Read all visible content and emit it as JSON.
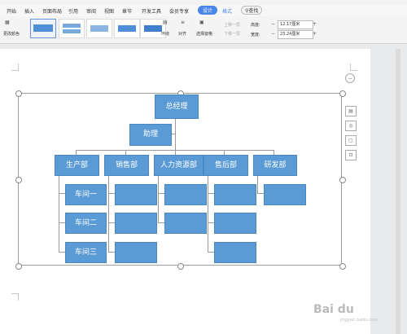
{
  "ribbon": {
    "tabs": [
      "开始",
      "插入",
      "页面布局",
      "引用",
      "审阅",
      "视图",
      "章节",
      "开发工具",
      "会员专享"
    ],
    "active_tab": "设计",
    "format_tab": "格式",
    "search_label": "查找",
    "change_color_label": "更改颜色",
    "env_label": "环绕",
    "align_label": "对齐",
    "select_pane_label": "选择窗格",
    "up_layer_label": "上移一层",
    "down_layer_label": "下移一层",
    "height_label": "高度:",
    "width_label": "宽度:",
    "height_value": "12.17厘米",
    "width_value": "23.24厘米",
    "accent_color": "#4a86e8"
  },
  "diagram": {
    "root": "总经理",
    "assistant": "助理",
    "departments": [
      "生产部",
      "销售部",
      "人力资源部",
      "售后部",
      "研发部"
    ],
    "workshops": [
      "车间一",
      "车间二",
      "车间三"
    ],
    "node_color": "#5b9bd5"
  },
  "side_tools": [
    "layout-options-icon",
    "style-icon",
    "fill-icon",
    "crop-icon"
  ],
  "watermark": {
    "text": "Bai du",
    "sub": "jingyan.baidu.com"
  }
}
